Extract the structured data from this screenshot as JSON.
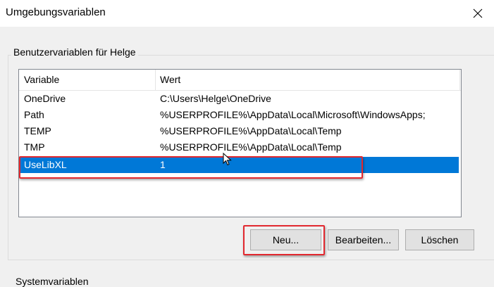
{
  "window": {
    "title": "Umgebungsvariablen"
  },
  "user_group": {
    "label": "Benutzervariablen für Helge",
    "columns": [
      "Variable",
      "Wert"
    ],
    "rows": [
      {
        "name": "OneDrive",
        "value": "C:\\Users\\Helge\\OneDrive"
      },
      {
        "name": "Path",
        "value": "%USERPROFILE%\\AppData\\Local\\Microsoft\\WindowsApps;"
      },
      {
        "name": "TEMP",
        "value": "%USERPROFILE%\\AppData\\Local\\Temp"
      },
      {
        "name": "TMP",
        "value": "%USERPROFILE%\\AppData\\Local\\Temp"
      },
      {
        "name": "UseLibXL",
        "value": "1"
      }
    ],
    "selected_row": "UseLibXL",
    "buttons": {
      "new": "Neu...",
      "edit": "Bearbeiten...",
      "delete": "Löschen"
    }
  },
  "system_group": {
    "label": "Systemvariablen"
  },
  "colors": {
    "selection": "#0078d7",
    "annotation": "#e2282f"
  },
  "icons": {
    "close": "close-icon",
    "cursor": "mouse-cursor-icon"
  }
}
